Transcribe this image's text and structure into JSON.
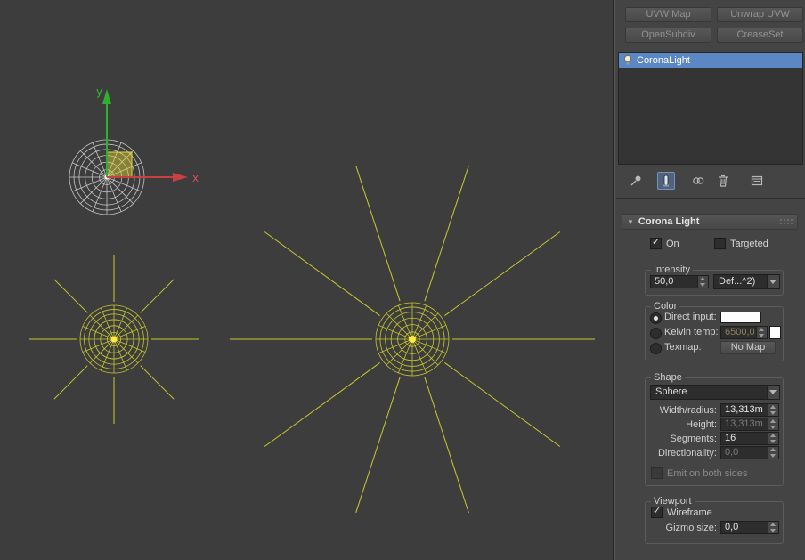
{
  "panel": {
    "modifier_buttons": [
      "UVW Map",
      "Unwrap UVW",
      "OpenSubdiv",
      "CreaseSet"
    ],
    "stack": {
      "selected": "CoronaLight"
    },
    "rollout_title": "Corona Light",
    "on_label": "On",
    "targeted_label": "Targeted",
    "intensity": {
      "group": "Intensity",
      "value": "50,0",
      "units": "Def...^2)"
    },
    "color": {
      "group": "Color",
      "direct_label": "Direct input:",
      "kelvin_label": "Kelvin temp:",
      "kelvin_value": "6500,0",
      "texmap_label": "Texmap:",
      "texmap_button": "No Map"
    },
    "shape": {
      "group": "Shape",
      "type": "Sphere",
      "rows": [
        {
          "label": "Width/radius:",
          "value": "13,313m",
          "disabled": false
        },
        {
          "label": "Height:",
          "value": "13,313m",
          "disabled": true
        },
        {
          "label": "Segments:",
          "value": "16",
          "disabled": false
        },
        {
          "label": "Directionality:",
          "value": "0,0",
          "disabled": true
        }
      ],
      "emit_label": "Emit on both sides"
    },
    "viewport_group": {
      "group": "Viewport",
      "wireframe_label": "Wireframe",
      "gizmo_label": "Gizmo size:",
      "gizmo_value": "0,0"
    }
  },
  "viewport": {
    "axis_x": "x",
    "axis_y": "y"
  },
  "colors": {
    "viewport_bg": "#3d3d3d",
    "panel_bg": "#444444",
    "selection_blue": "#5b87c5",
    "gizmo_yellow": "#c9c92e",
    "gizmo_center": "#ffe93e",
    "wire_white": "#c4c4c4",
    "axis_green": "#2fae2f",
    "axis_red": "#c84040",
    "plane_handle_fill": "rgba(226,211,52,0.45)",
    "plane_handle_stroke": "#e6d62e"
  }
}
